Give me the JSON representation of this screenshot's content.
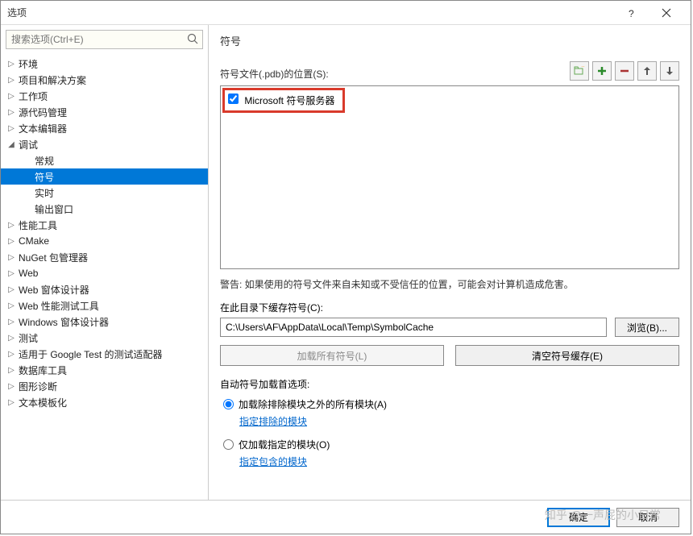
{
  "window": {
    "title": "选项"
  },
  "search": {
    "placeholder": "搜索选项(Ctrl+E)"
  },
  "tree": {
    "items": [
      {
        "label": "环境",
        "expanded": false,
        "children": []
      },
      {
        "label": "项目和解决方案",
        "expanded": false,
        "children": []
      },
      {
        "label": "工作项",
        "expanded": false,
        "children": []
      },
      {
        "label": "源代码管理",
        "expanded": false,
        "children": []
      },
      {
        "label": "文本编辑器",
        "expanded": false,
        "children": []
      },
      {
        "label": "调试",
        "expanded": true,
        "children": [
          {
            "label": "常规",
            "selected": false
          },
          {
            "label": "符号",
            "selected": true
          },
          {
            "label": "实时",
            "selected": false
          },
          {
            "label": "输出窗口",
            "selected": false
          }
        ]
      },
      {
        "label": "性能工具",
        "expanded": false,
        "children": []
      },
      {
        "label": "CMake",
        "expanded": false,
        "children": []
      },
      {
        "label": "NuGet 包管理器",
        "expanded": false,
        "children": []
      },
      {
        "label": "Web",
        "expanded": false,
        "children": []
      },
      {
        "label": "Web 窗体设计器",
        "expanded": false,
        "children": []
      },
      {
        "label": "Web 性能测试工具",
        "expanded": false,
        "children": []
      },
      {
        "label": "Windows 窗体设计器",
        "expanded": false,
        "children": []
      },
      {
        "label": "测试",
        "expanded": false,
        "children": []
      },
      {
        "label": "适用于 Google Test 的测试适配器",
        "expanded": false,
        "children": []
      },
      {
        "label": "数据库工具",
        "expanded": false,
        "children": []
      },
      {
        "label": "图形诊断",
        "expanded": false,
        "children": []
      },
      {
        "label": "文本模板化",
        "expanded": false,
        "children": []
      }
    ]
  },
  "panel": {
    "heading": "符号",
    "locations_label": "符号文件(.pdb)的位置(S):",
    "ms_server_label": "Microsoft 符号服务器",
    "ms_server_checked": true,
    "warning": "警告: 如果使用的符号文件来自未知或不受信任的位置，可能会对计算机造成危害。",
    "cache_label": "在此目录下缓存符号(C):",
    "cache_path": "C:\\Users\\AF\\AppData\\Local\\Temp\\SymbolCache",
    "browse_btn": "浏览(B)...",
    "load_all_btn": "加载所有符号(L)",
    "clear_cache_btn": "清空符号缓存(E)",
    "auto_label": "自动符号加载首选项:",
    "radio1_label": "加载除排除模块之外的所有模块(A)",
    "link1": "指定排除的模块",
    "radio2_label": "仅加载指定的模块(O)",
    "link2": "指定包含的模块",
    "radio_selected": 0
  },
  "footer": {
    "ok": "确定",
    "cancel": "取消"
  },
  "watermark": "知乎 @一声屁的小日常"
}
